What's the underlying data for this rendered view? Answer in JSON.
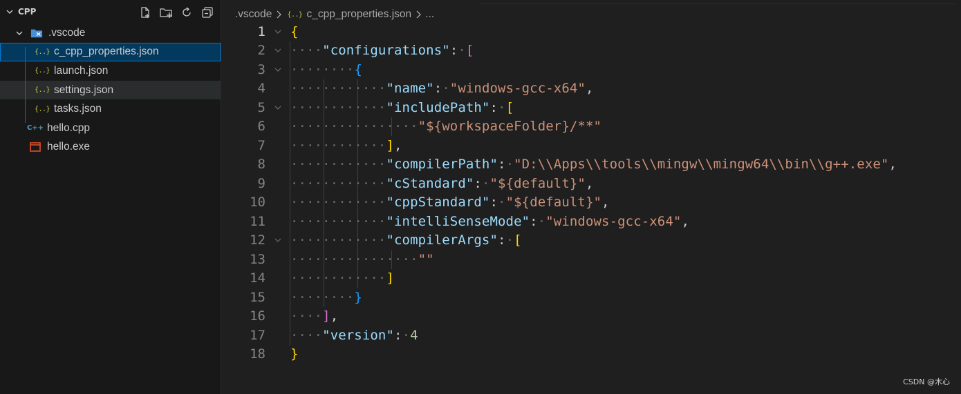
{
  "explorer": {
    "title": "CPP",
    "actions": [
      "new-file",
      "new-folder",
      "refresh",
      "collapse-all"
    ],
    "items": [
      {
        "label": ".vscode",
        "type": "folder",
        "expanded": true
      },
      {
        "label": "c_cpp_properties.json",
        "type": "json",
        "selected": true
      },
      {
        "label": "launch.json",
        "type": "json"
      },
      {
        "label": "settings.json",
        "type": "json",
        "hovered": true
      },
      {
        "label": "tasks.json",
        "type": "json"
      },
      {
        "label": "hello.cpp",
        "type": "cpp"
      },
      {
        "label": "hello.exe",
        "type": "exe"
      }
    ]
  },
  "breadcrumb": {
    "folder": ".vscode",
    "file": "c_cpp_properties.json",
    "more": "..."
  },
  "editor": {
    "line_numbers": [
      "1",
      "2",
      "3",
      "4",
      "5",
      "6",
      "7",
      "8",
      "9",
      "10",
      "11",
      "12",
      "13",
      "14",
      "15",
      "16",
      "17",
      "18"
    ],
    "tokens": {
      "open_brace": "{",
      "close_brace": "}",
      "open_bracket": "[",
      "close_bracket": "]",
      "colon": ":",
      "comma": ",",
      "configurations": "\"configurations\"",
      "name_key": "\"name\"",
      "name_val": "\"windows-gcc-x64\"",
      "includePath_key": "\"includePath\"",
      "includePath_val": "\"${workspaceFolder}/**\"",
      "compilerPath_key": "\"compilerPath\"",
      "compilerPath_val": "\"D:\\\\Apps\\\\tools\\\\mingw\\\\mingw64\\\\bin\\\\g++.exe\"",
      "cStandard_key": "\"cStandard\"",
      "cStandard_val": "\"${default}\"",
      "cppStandard_key": "\"cppStandard\"",
      "cppStandard_val": "\"${default}\"",
      "intelliSenseMode_key": "\"intelliSenseMode\"",
      "intelliSenseMode_val": "\"windows-gcc-x64\"",
      "compilerArgs_key": "\"compilerArgs\"",
      "compilerArgs_val": "\"\"",
      "version_key": "\"version\"",
      "version_val": "4"
    }
  },
  "watermark": "CSDN @木心",
  "colors": {
    "selection": "#04395e",
    "focus_border": "#0078d4",
    "json_icon": "#cbcb41",
    "cpp_icon": "#519aba",
    "exe_icon": "#e44d26"
  }
}
